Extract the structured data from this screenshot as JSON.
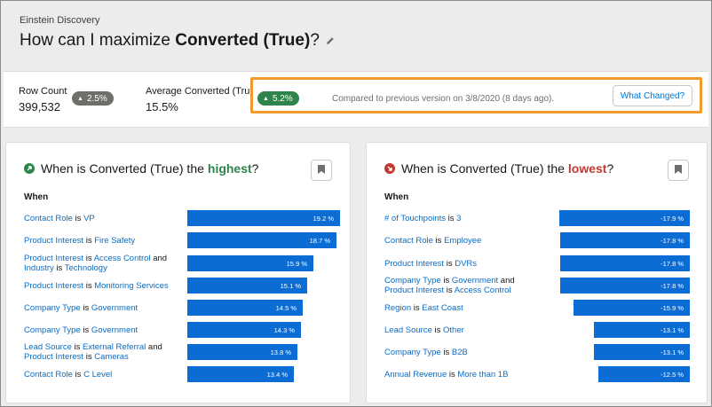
{
  "header": {
    "app_name": "Einstein Discovery",
    "title_prefix": "How can I maximize ",
    "title_bold": "Converted (True)",
    "title_suffix": "?"
  },
  "stats": {
    "row_count_label": "Row Count",
    "row_count_value": "399,532",
    "row_count_change": "2.5%",
    "avg_label": "Average Converted (True)",
    "avg_value": "15.5%",
    "version_change": "5.2%",
    "compared_text": "Compared to previous version on 3/8/2020 (8 days ago).",
    "what_changed_label": "What Changed?"
  },
  "colors": {
    "link": "#0b6cc4",
    "bar": "#0b6cd4",
    "positive": "#2e844a",
    "negative": "#c23934",
    "highlight_border": "#f29a2e"
  },
  "icons": {
    "edit": "pencil-icon",
    "up": "arrow-up-right-icon",
    "down": "arrow-down-right-icon",
    "bookmark": "bookmark-icon"
  },
  "highest": {
    "title_prefix": "When is Converted (True) the",
    "title_emphasis": "highest",
    "title_suffix": "?",
    "when_label": "When",
    "rows": [
      {
        "parts": [
          {
            "t": "Contact Role",
            "l": true
          },
          {
            "t": " is ",
            "l": false
          },
          {
            "t": "VP",
            "l": true
          }
        ],
        "value": 19.2,
        "label": "19.2 %"
      },
      {
        "parts": [
          {
            "t": "Product Interest",
            "l": true
          },
          {
            "t": " is ",
            "l": false
          },
          {
            "t": "Fire Safety",
            "l": true
          }
        ],
        "value": 18.7,
        "label": "18.7 %"
      },
      {
        "parts": [
          {
            "t": "Product Interest",
            "l": true
          },
          {
            "t": " is ",
            "l": false
          },
          {
            "t": "Access Control",
            "l": true
          },
          {
            "t": " and ",
            "l": false
          },
          {
            "br": true
          },
          {
            "t": "Industry",
            "l": true
          },
          {
            "t": " is ",
            "l": false
          },
          {
            "t": "Technology",
            "l": true
          }
        ],
        "value": 15.9,
        "label": "15.9 %"
      },
      {
        "parts": [
          {
            "t": "Product Interest",
            "l": true
          },
          {
            "t": " is ",
            "l": false
          },
          {
            "t": "Monitoring Services",
            "l": true
          }
        ],
        "value": 15.1,
        "label": "15.1 %"
      },
      {
        "parts": [
          {
            "t": "Company Type",
            "l": true
          },
          {
            "t": " is ",
            "l": false
          },
          {
            "t": "Government",
            "l": true
          }
        ],
        "value": 14.5,
        "label": "14.5 %"
      },
      {
        "parts": [
          {
            "t": "Company Type",
            "l": true
          },
          {
            "t": " is ",
            "l": false
          },
          {
            "t": "Government",
            "l": true
          }
        ],
        "value": 14.3,
        "label": "14.3 %"
      },
      {
        "parts": [
          {
            "t": "Lead Source",
            "l": true
          },
          {
            "t": " is ",
            "l": false
          },
          {
            "t": "External Referral",
            "l": true
          },
          {
            "t": " and",
            "l": false
          },
          {
            "br": true
          },
          {
            "t": "Product Interest",
            "l": true
          },
          {
            "t": " is ",
            "l": false
          },
          {
            "t": "Cameras",
            "l": true
          }
        ],
        "value": 13.8,
        "label": "13.8 %"
      },
      {
        "parts": [
          {
            "t": "Contact Role",
            "l": true
          },
          {
            "t": " is ",
            "l": false
          },
          {
            "t": "C Level",
            "l": true
          }
        ],
        "value": 13.4,
        "label": "13.4 %"
      }
    ]
  },
  "lowest": {
    "title_prefix": "When is Converted (True) the",
    "title_emphasis": "lowest",
    "title_suffix": "?",
    "when_label": "When",
    "rows": [
      {
        "parts": [
          {
            "t": "# of Touchpoints",
            "l": true
          },
          {
            "t": " is ",
            "l": false
          },
          {
            "t": "3",
            "l": true
          }
        ],
        "value": -17.9,
        "label": "-17.9 %"
      },
      {
        "parts": [
          {
            "t": "Contact Role",
            "l": true
          },
          {
            "t": " is ",
            "l": false
          },
          {
            "t": "Employee",
            "l": true
          }
        ],
        "value": -17.8,
        "label": "-17.8 %"
      },
      {
        "parts": [
          {
            "t": "Product Interest",
            "l": true
          },
          {
            "t": " is ",
            "l": false
          },
          {
            "t": "DVRs",
            "l": true
          }
        ],
        "value": -17.8,
        "label": "-17.8 %"
      },
      {
        "parts": [
          {
            "t": "Company Type",
            "l": true
          },
          {
            "t": " is ",
            "l": false
          },
          {
            "t": "Government",
            "l": true
          },
          {
            "t": " and",
            "l": false
          },
          {
            "br": true
          },
          {
            "t": "Product Interest",
            "l": true
          },
          {
            "t": " is ",
            "l": false
          },
          {
            "t": "Access Control",
            "l": true
          }
        ],
        "value": -17.8,
        "label": "-17.8 %"
      },
      {
        "parts": [
          {
            "t": "Region",
            "l": true
          },
          {
            "t": " is ",
            "l": false
          },
          {
            "t": "East Coast",
            "l": true
          }
        ],
        "value": -15.9,
        "label": "-15.9 %"
      },
      {
        "parts": [
          {
            "t": "Lead Source",
            "l": true
          },
          {
            "t": " is ",
            "l": false
          },
          {
            "t": "Other",
            "l": true
          }
        ],
        "value": -13.1,
        "label": "-13.1 %"
      },
      {
        "parts": [
          {
            "t": "Company Type",
            "l": true
          },
          {
            "t": " is ",
            "l": false
          },
          {
            "t": "B2B",
            "l": true
          }
        ],
        "value": -13.1,
        "label": "-13.1 %"
      },
      {
        "parts": [
          {
            "t": "Annual Revenue",
            "l": true
          },
          {
            "t": " is ",
            "l": false
          },
          {
            "t": "More than 1B",
            "l": true
          }
        ],
        "value": -12.5,
        "label": "-12.5 %"
      }
    ]
  }
}
